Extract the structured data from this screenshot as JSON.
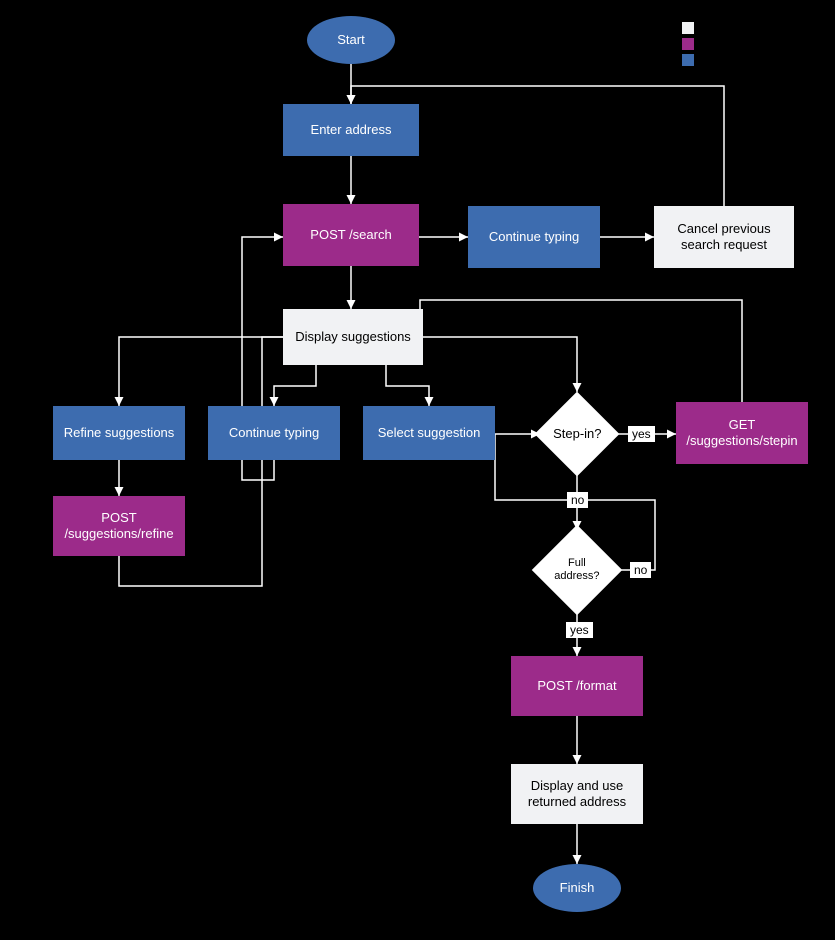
{
  "colors": {
    "blue": "#3d6caf",
    "purple": "#9c2b8a",
    "white": "#f1f2f4"
  },
  "legend": {
    "swatches": [
      "white",
      "purple",
      "blue"
    ]
  },
  "nodes": {
    "start": {
      "label": "Start"
    },
    "enter": {
      "label": "Enter address"
    },
    "post_search": {
      "label": "POST /search"
    },
    "cont_typing_top": {
      "label": "Continue typing"
    },
    "cancel_prev": {
      "label": "Cancel previous search request"
    },
    "display_sugg": {
      "label": "Display suggestions"
    },
    "refine_sugg": {
      "label": "Refine suggestions"
    },
    "cont_typing_mid": {
      "label": "Continue typing"
    },
    "select_sugg": {
      "label": "Select suggestion"
    },
    "step_in": {
      "label": "Step-in?"
    },
    "get_stepin": {
      "label": "GET /suggestions/stepin"
    },
    "post_refine": {
      "label": "POST /suggestions/refine"
    },
    "full_addr": {
      "label": "Full address?"
    },
    "post_format": {
      "label": "POST /format"
    },
    "display_return": {
      "label": "Display and use returned address"
    },
    "finish": {
      "label": "Finish"
    }
  },
  "edge_labels": {
    "step_in_yes": "yes",
    "step_in_no": "no",
    "full_yes": "yes",
    "full_no": "no"
  }
}
